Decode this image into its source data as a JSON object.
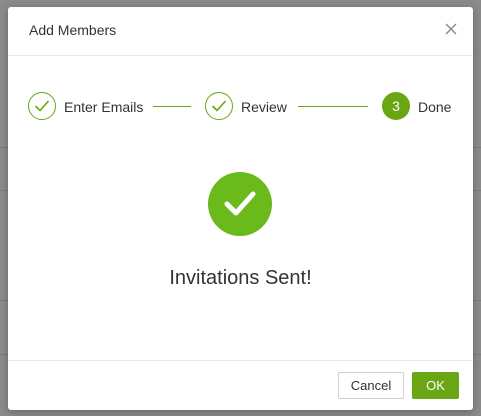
{
  "dialog": {
    "title": "Add Members",
    "close_icon": "close-icon"
  },
  "stepper": {
    "steps": [
      {
        "label": "Enter Emails",
        "status": "done",
        "icon": "check-icon"
      },
      {
        "label": "Review",
        "status": "done",
        "icon": "check-icon"
      },
      {
        "label": "Done",
        "status": "active",
        "number": "3"
      }
    ]
  },
  "success": {
    "icon": "check-icon",
    "message": "Invitations Sent!"
  },
  "footer": {
    "cancel_label": "Cancel",
    "ok_label": "OK"
  },
  "colors": {
    "accent": "#6aa514",
    "success": "#6aba1c",
    "overlay": "#8a8a8a"
  }
}
